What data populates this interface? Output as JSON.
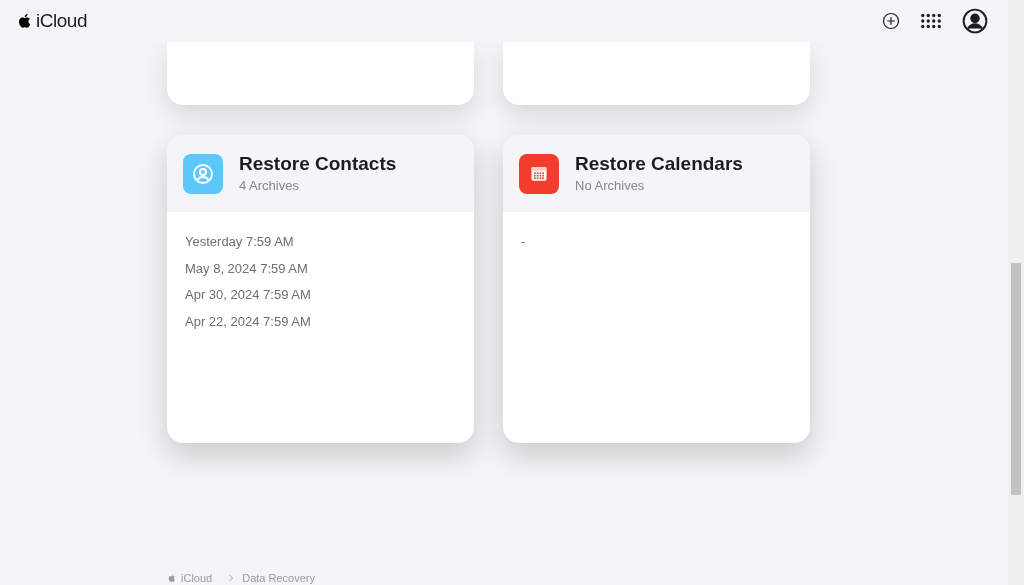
{
  "header": {
    "brand": "iCloud"
  },
  "cards": [
    {
      "kind": "contacts",
      "title": "Restore Contacts",
      "subtitle": "4 Archives",
      "archives": [
        "Yesterday 7:59 AM",
        "May 8, 2024 7:59 AM",
        "Apr 30, 2024 7:59 AM",
        "Apr 22, 2024 7:59 AM"
      ]
    },
    {
      "kind": "calendars",
      "title": "Restore Calendars",
      "subtitle": "No Archives",
      "archives": [
        "-"
      ]
    }
  ],
  "breadcrumb": [
    "iCloud",
    "Data Recovery"
  ]
}
